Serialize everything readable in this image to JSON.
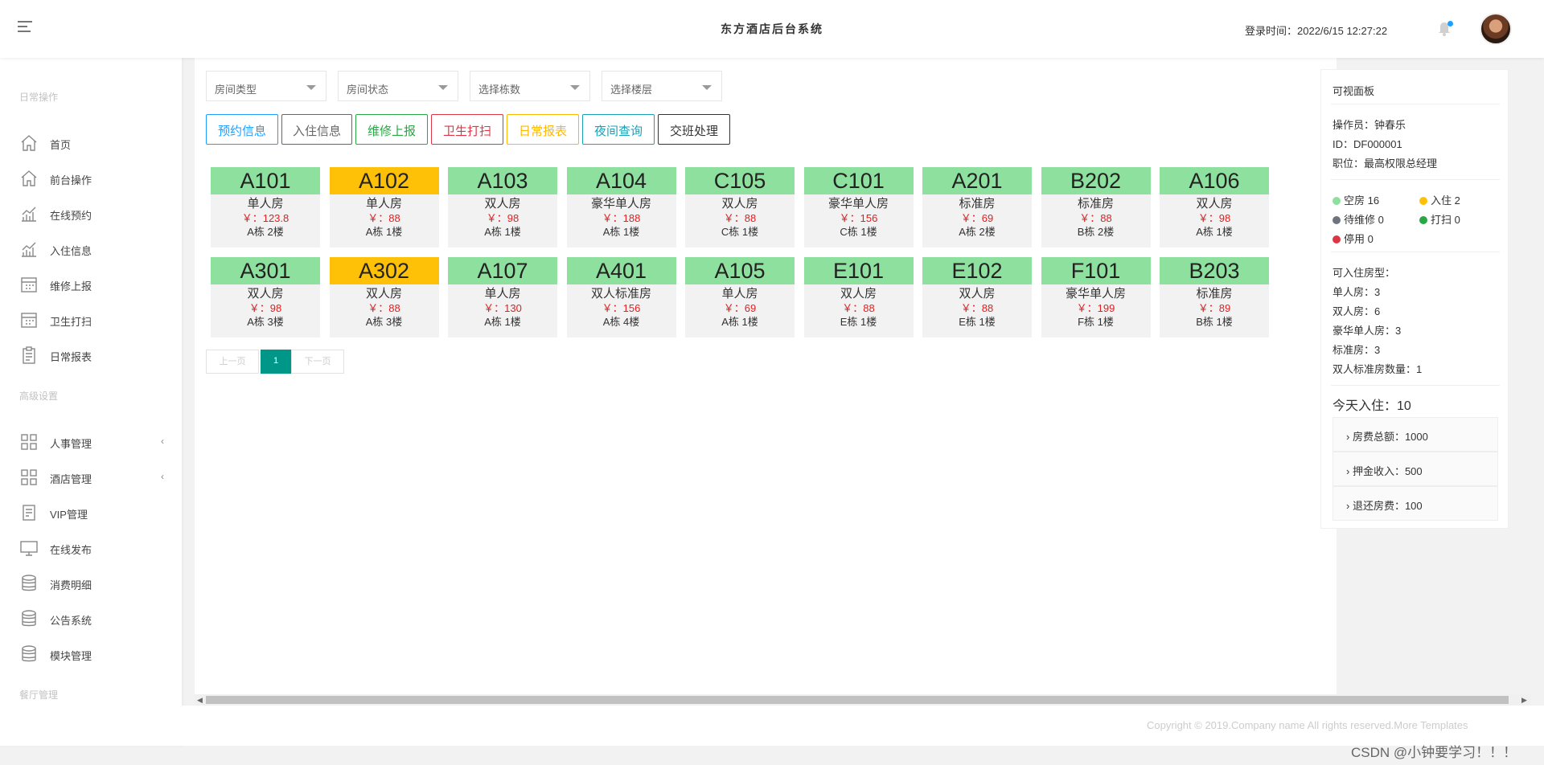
{
  "header": {
    "title": "东方酒店后台系统",
    "login_time": "登录时间：2022/6/15 12:27:22"
  },
  "sidebar": {
    "section1": "日常操作",
    "items1": [
      {
        "label": "首页",
        "icon": "home-icon"
      },
      {
        "label": "前台操作",
        "icon": "home-icon"
      },
      {
        "label": "在线预约",
        "icon": "chart-icon"
      },
      {
        "label": "入住信息",
        "icon": "chart-icon"
      },
      {
        "label": "维修上报",
        "icon": "calendar-icon"
      },
      {
        "label": "卫生打扫",
        "icon": "calendar-icon"
      },
      {
        "label": "日常报表",
        "icon": "clipboard-icon"
      }
    ],
    "section2": "高级设置",
    "items2": [
      {
        "label": "人事管理",
        "icon": "grid-icon",
        "arrow": "‹"
      },
      {
        "label": "酒店管理",
        "icon": "grid-icon",
        "arrow": "‹"
      },
      {
        "label": "VIP管理",
        "icon": "document-icon"
      },
      {
        "label": "在线发布",
        "icon": "monitor-icon"
      },
      {
        "label": "消费明细",
        "icon": "database-icon"
      },
      {
        "label": "公告系统",
        "icon": "database-icon"
      },
      {
        "label": "模块管理",
        "icon": "database-icon"
      }
    ],
    "section3": "餐厅管理"
  },
  "filters": {
    "room_type": "房间类型",
    "room_status": "房间状态",
    "building": "选择栋数",
    "floor": "选择楼层"
  },
  "actions": [
    {
      "label": "预约信息",
      "color": "#1e9fff"
    },
    {
      "label": "入住信息",
      "color": "#666666"
    },
    {
      "label": "维修上报",
      "color": "#28a745"
    },
    {
      "label": "卫生打扫",
      "color": "#dc3545"
    },
    {
      "label": "日常报表",
      "color": "#ffb800"
    },
    {
      "label": "夜间查询",
      "color": "#17a2b8"
    },
    {
      "label": "交班处理",
      "color": "#333333"
    }
  ],
  "status_colors": {
    "vacant": "#8ee09e",
    "occupied": "#ffc107"
  },
  "rooms": [
    {
      "num": "A101",
      "type": "单人房",
      "price": "￥：123.8",
      "loc": "A栋 2楼",
      "status": "vacant"
    },
    {
      "num": "A102",
      "type": "单人房",
      "price": "￥：88",
      "loc": "A栋 1楼",
      "status": "occupied"
    },
    {
      "num": "A103",
      "type": "双人房",
      "price": "￥：98",
      "loc": "A栋 1楼",
      "status": "vacant"
    },
    {
      "num": "A104",
      "type": "豪华单人房",
      "price": "￥：188",
      "loc": "A栋 1楼",
      "status": "vacant"
    },
    {
      "num": "C105",
      "type": "双人房",
      "price": "￥：88",
      "loc": "C栋 1楼",
      "status": "vacant"
    },
    {
      "num": "C101",
      "type": "豪华单人房",
      "price": "￥：156",
      "loc": "C栋 1楼",
      "status": "vacant"
    },
    {
      "num": "A201",
      "type": "标准房",
      "price": "￥：69",
      "loc": "A栋 2楼",
      "status": "vacant"
    },
    {
      "num": "B202",
      "type": "标准房",
      "price": "￥：88",
      "loc": "B栋 2楼",
      "status": "vacant"
    },
    {
      "num": "A106",
      "type": "双人房",
      "price": "￥：98",
      "loc": "A栋 1楼",
      "status": "vacant"
    },
    {
      "num": "A301",
      "type": "双人房",
      "price": "￥：98",
      "loc": "A栋 3楼",
      "status": "vacant"
    },
    {
      "num": "A302",
      "type": "双人房",
      "price": "￥：88",
      "loc": "A栋 3楼",
      "status": "occupied"
    },
    {
      "num": "A107",
      "type": "单人房",
      "price": "￥：130",
      "loc": "A栋 1楼",
      "status": "vacant"
    },
    {
      "num": "A401",
      "type": "双人标准房",
      "price": "￥：156",
      "loc": "A栋 4楼",
      "status": "vacant"
    },
    {
      "num": "A105",
      "type": "单人房",
      "price": "￥：69",
      "loc": "A栋 1楼",
      "status": "vacant"
    },
    {
      "num": "E101",
      "type": "双人房",
      "price": "￥：88",
      "loc": "E栋 1楼",
      "status": "vacant"
    },
    {
      "num": "E102",
      "type": "双人房",
      "price": "￥：88",
      "loc": "E栋 1楼",
      "status": "vacant"
    },
    {
      "num": "F101",
      "type": "豪华单人房",
      "price": "￥：199",
      "loc": "F栋 1楼",
      "status": "vacant"
    },
    {
      "num": "B203",
      "type": "标准房",
      "price": "￥：89",
      "loc": "B栋 1楼",
      "status": "vacant"
    }
  ],
  "pager": {
    "prev": "上一页",
    "current": "1",
    "next": "下一页"
  },
  "panel": {
    "title": "可视面板",
    "operator": "操作员：钟春乐",
    "id": "ID：DF000001",
    "role": "职位：最高权限总经理",
    "legend": [
      {
        "label": "空房 16",
        "color": "#8ee09e"
      },
      {
        "label": "入住 2",
        "color": "#ffc107"
      },
      {
        "label": "待维修 0",
        "color": "#6c757d"
      },
      {
        "label": "打扫 0",
        "color": "#28a745"
      },
      {
        "label": "停用 0",
        "color": "#dc3545"
      }
    ],
    "available_title": "可入住房型：",
    "available": [
      "单人房：3",
      "双人房：6",
      "豪华单人房：3",
      "标准房：3",
      "双人标准房数量：1"
    ],
    "today": "今天入住：10",
    "collapses": [
      "房费总额：1000",
      "押金收入：500",
      "退还房费：100"
    ]
  },
  "footer": {
    "copyright": "Copyright © 2019.Company name All rights reserved.More Templates",
    "watermark": "CSDN @小钟要学习！！！"
  }
}
